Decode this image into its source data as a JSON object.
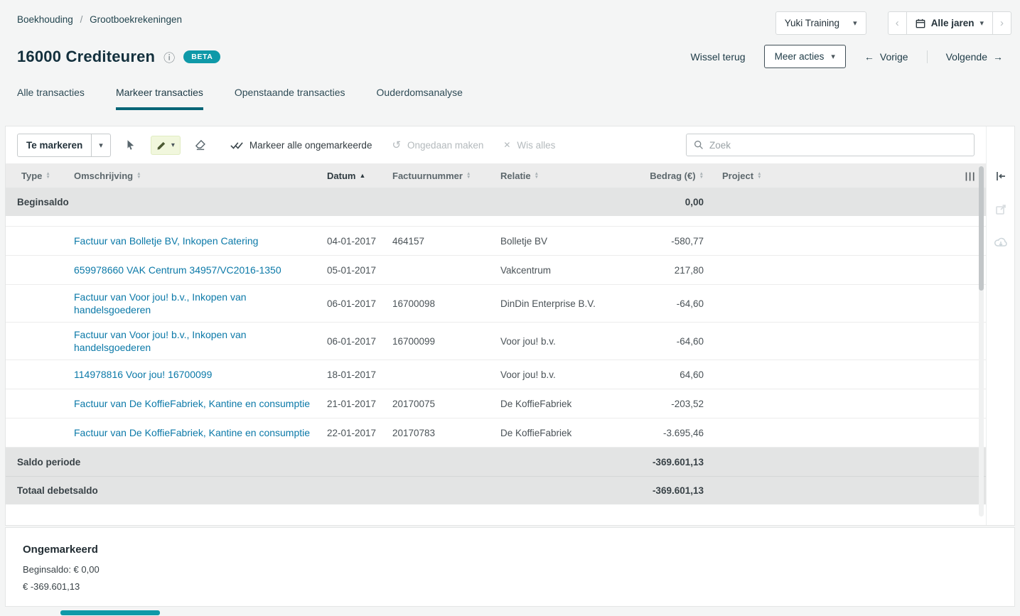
{
  "breadcrumb": {
    "items": [
      "Boekhouding",
      "Grootboekrekeningen"
    ],
    "separator": "/"
  },
  "topbar": {
    "company": "Yuki Training",
    "year_filter": "Alle jaren"
  },
  "header": {
    "title": "16000 Crediteuren",
    "beta_badge": "BETA",
    "wissel_terug": "Wissel terug",
    "meer_acties": "Meer acties",
    "vorige": "Vorige",
    "volgende": "Volgende"
  },
  "tabs": [
    {
      "label": "Alle transacties"
    },
    {
      "label": "Markeer transacties"
    },
    {
      "label": "Openstaande transacties"
    },
    {
      "label": "Ouderdomsanalyse"
    }
  ],
  "toolbar": {
    "mode_dropdown": "Te markeren",
    "markeer_alle": "Markeer alle ongemarkeerde",
    "ongedaan": "Ongedaan maken",
    "wis_alles": "Wis alles",
    "search_placeholder": "Zoek"
  },
  "table": {
    "columns": [
      "Type",
      "Omschrijving",
      "Datum",
      "Factuurnummer",
      "Relatie",
      "Bedrag (€)",
      "Project"
    ],
    "beginsaldo": {
      "label": "Beginsaldo",
      "amount": "0,00"
    },
    "rows": [
      {
        "icon": "invoice-icon",
        "description": "Factuur van Bolletje BV, Inkopen Catering",
        "date": "04-01-2017",
        "invoice": "464157",
        "relation": "Bolletje BV",
        "amount": "-580,77"
      },
      {
        "icon": "bank-statement-icon",
        "description": "659978660 VAK Centrum 34957/VC2016-1350",
        "date": "05-01-2017",
        "invoice": "",
        "relation": "Vakcentrum",
        "amount": "217,80"
      },
      {
        "icon": "invoice-icon",
        "description": "Factuur van Voor jou! b.v., Inkopen van handelsgoederen",
        "date": "06-01-2017",
        "invoice": "16700098",
        "relation": "DinDin Enterprise B.V.",
        "amount": "-64,60"
      },
      {
        "icon": "invoice-icon",
        "description": "Factuur van Voor jou! b.v., Inkopen van handelsgoederen",
        "date": "06-01-2017",
        "invoice": "16700099",
        "relation": "Voor jou! b.v.",
        "amount": "-64,60"
      },
      {
        "icon": "bank-statement-icon",
        "description": "114978816 Voor jou! 16700099",
        "date": "18-01-2017",
        "invoice": "",
        "relation": "Voor jou! b.v.",
        "amount": "64,60"
      },
      {
        "icon": "invoice-icon",
        "description": "Factuur van De KoffieFabriek, Kantine en consumptie",
        "date": "21-01-2017",
        "invoice": "20170075",
        "relation": "De KoffieFabriek",
        "amount": "-203,52"
      },
      {
        "icon": "invoice-icon",
        "description": "Factuur van De KoffieFabriek, Kantine en consumptie",
        "date": "22-01-2017",
        "invoice": "20170783",
        "relation": "De KoffieFabriek",
        "amount": "-3.695,46"
      }
    ],
    "saldo_periode": {
      "label": "Saldo periode",
      "amount": "-369.601,13"
    },
    "totaal_debetsaldo": {
      "label": "Totaal debetsaldo",
      "amount": "-369.601,13"
    }
  },
  "summary": {
    "title": "Ongemarkeerd",
    "beginsaldo": "Beginsaldo: € 0,00",
    "total": "€ -369.601,13"
  },
  "colors": {
    "accent_teal": "#0f99a8",
    "tab_underline": "#076577",
    "link": "#0b79a8"
  }
}
